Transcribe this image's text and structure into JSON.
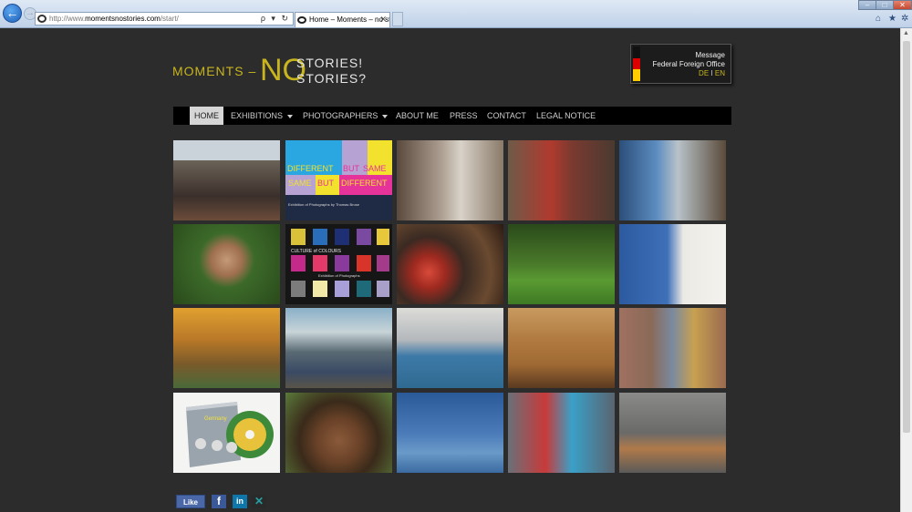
{
  "browser": {
    "address": {
      "domain_prefix": "http://www.",
      "domain": "momentsnostories.com",
      "path": "/start/",
      "tools": "ρ ▾ ↻"
    },
    "tab": {
      "label": "Home – Moments – no stor...",
      "close": "✕"
    },
    "window": {
      "minimize": "–",
      "maximize": "□",
      "close": "✕"
    },
    "right_icons": {
      "home": "home-icon",
      "favorites": "star-icon",
      "tools": "gear-icon"
    }
  },
  "site": {
    "logo": {
      "moments": "MOMENTS –",
      "no": "NO",
      "stories1": "STORIES!",
      "stories2": "STORIES?"
    },
    "badge": {
      "line1": "Message",
      "line2": "Federal Foreign Office",
      "lang_de": "DE",
      "lang_sep": "I",
      "lang_en": "EN"
    },
    "menu": [
      {
        "label": "HOME",
        "active": true
      },
      {
        "label": "EXHIBITIONS",
        "dropdown": true
      },
      {
        "label": "PHOTOGRAPHERS",
        "dropdown": true
      },
      {
        "label": "ABOUT ME"
      },
      {
        "label": "PRESS"
      },
      {
        "label": "CONTACT"
      },
      {
        "label": "LEGAL NOTICE"
      }
    ],
    "tile_poster1": {
      "t1": "DIFFERENT",
      "t2": "BUT",
      "t3": "SAME",
      "t4": "SAME",
      "t5": "BUT",
      "t6": "DIFFERENT",
      "foot": "Exhibition of Photographs by Thomas Brose"
    },
    "tile_poster2": {
      "t1": "CULTURE of COLOURS",
      "t2": "Exhibition of Photographs"
    },
    "tile_cd": {
      "label": "Germany"
    },
    "social": {
      "like": "Like",
      "fb": "f",
      "li": "in",
      "xing": "✕"
    }
  },
  "colors": {
    "accent": "#c8b51e",
    "bg": "#2c2c2c",
    "menu": "#000000"
  }
}
